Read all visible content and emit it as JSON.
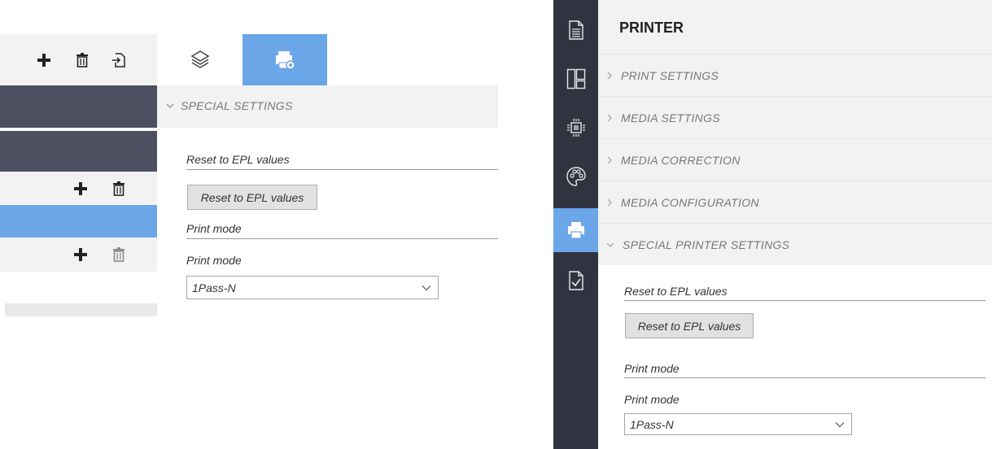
{
  "left": {
    "special_settings_label": "SPECIAL SETTINGS",
    "reset_group_label": "Reset to EPL values",
    "reset_button_label": "Reset to EPL values",
    "print_mode_group_label": "Print mode",
    "print_mode_field_label": "Print mode",
    "print_mode_value": "1Pass-N"
  },
  "right": {
    "title": "PRINTER",
    "sections": [
      {
        "label": "PRINT SETTINGS"
      },
      {
        "label": "MEDIA SETTINGS"
      },
      {
        "label": "MEDIA CORRECTION"
      },
      {
        "label": "MEDIA CONFIGURATION"
      },
      {
        "label": "SPECIAL PRINTER SETTINGS"
      }
    ],
    "reset_group_label": "Reset to EPL values",
    "reset_button_label": "Reset to EPL values",
    "print_mode_group_label": "Print mode",
    "print_mode_field_label": "Print mode",
    "print_mode_value": "1Pass-N"
  },
  "icons": {
    "toolbar": [
      "plus-icon",
      "trash-icon",
      "import-icon"
    ],
    "tabs": [
      "layers-icon",
      "printer-settings-icon"
    ],
    "nav": [
      "document-icon",
      "layout-icon",
      "chip-icon",
      "palette-icon",
      "printer-icon",
      "check-document-icon"
    ]
  },
  "colors": {
    "accent": "#6aa6e8",
    "dark_row": "#4c5061",
    "side_nav": "#2f3440",
    "panel_bg": "#f2f2f2"
  }
}
